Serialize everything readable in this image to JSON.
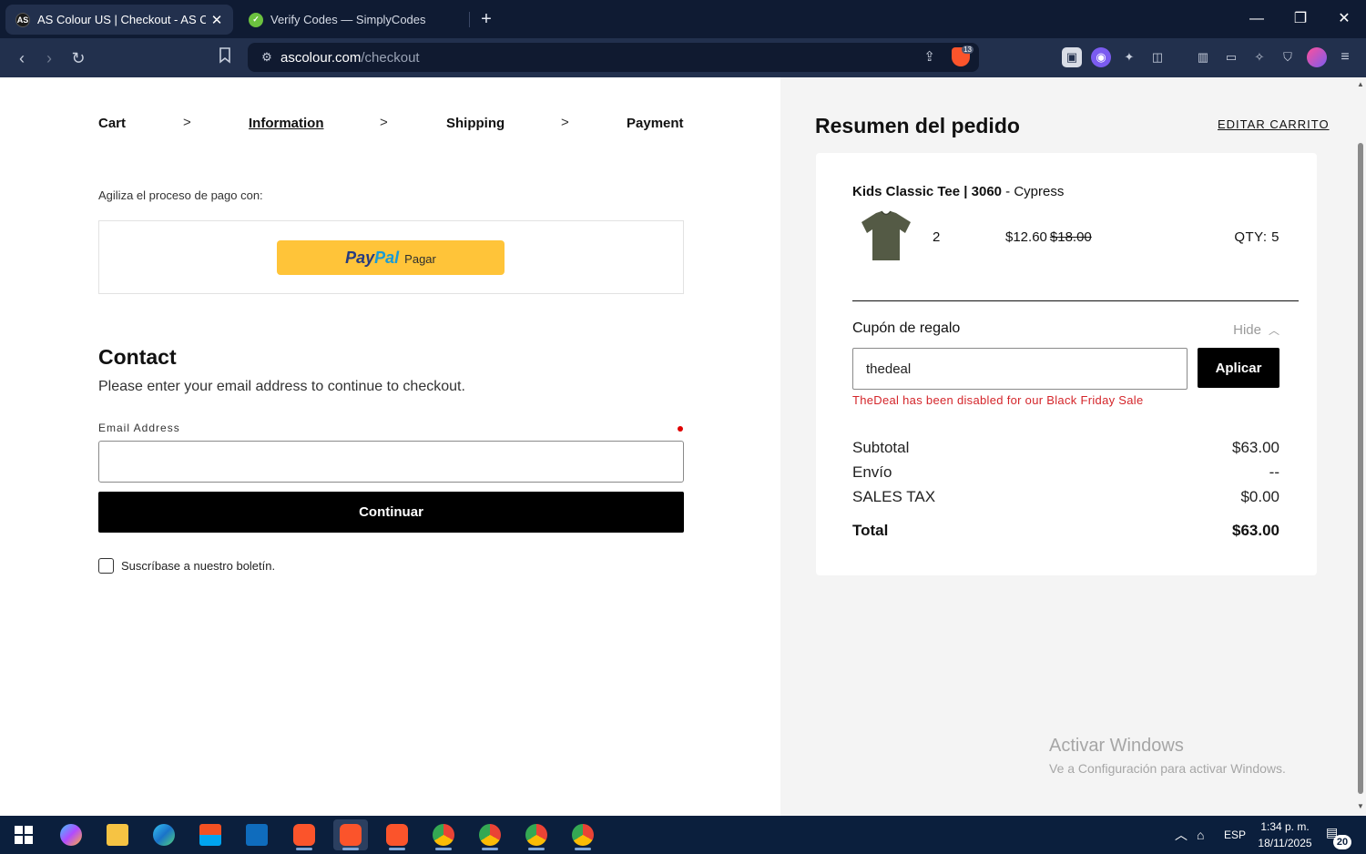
{
  "browser": {
    "tabs": [
      {
        "title": "AS Colour US | Checkout - AS Co",
        "favicon": "as-colour-icon",
        "active": true
      },
      {
        "title": "Verify Codes — SimplyCodes",
        "favicon": "simplycodes-icon",
        "active": false
      }
    ],
    "url_host": "ascolour.com",
    "url_path": "/checkout",
    "shield_count": "13"
  },
  "checkout": {
    "breadcrumb": {
      "cart": "Cart",
      "information": "Information",
      "shipping": "Shipping",
      "payment": "Payment",
      "current": "Information"
    },
    "express_label": "Agiliza el proceso de pago con:",
    "paypal": {
      "logo_pay": "Pay",
      "logo_pal": "Pal",
      "text": "Pagar"
    },
    "contact_title": "Contact",
    "contact_subtitle": "Please enter your email address to continue to checkout.",
    "email_label": "Email Address",
    "email_value": "",
    "continue_label": "Continuar",
    "newsletter_label": "Suscríbase a nuestro boletín.",
    "newsletter_checked": false
  },
  "summary": {
    "title": "Resumen del pedido",
    "edit_cart": "EDITAR CARRITO",
    "product": {
      "name_bold": "Kids Classic Tee | 3060",
      "variant": " - Cypress",
      "count": "2",
      "price": "$12.60",
      "old_price": "$18.00",
      "qty_label": "QTY: 5",
      "color": "#545a45"
    },
    "coupon": {
      "label": "Cupón de regalo",
      "toggle": "Hide",
      "value": "thedeal",
      "apply_label": "Aplicar",
      "error": "TheDeal has been disabled for our Black Friday Sale"
    },
    "subtotal_label": "Subtotal",
    "subtotal_value": "$63.00",
    "shipping_label": "Envío",
    "shipping_value": "--",
    "tax_label": "SALES TAX",
    "tax_value": "$0.00",
    "total_label": "Total",
    "total_value": "$63.00"
  },
  "watermark": {
    "line1": "Activar Windows",
    "line2": "Ve a Configuración para activar Windows."
  },
  "taskbar": {
    "language": "ESP",
    "time": "1:34 p. m.",
    "date": "18/11/2025",
    "notifications": "20"
  },
  "colors": {
    "accent_black": "#000000",
    "error_red": "#d4252a",
    "paypal_yellow": "#ffc439",
    "summary_bg": "#f4f4f4"
  }
}
